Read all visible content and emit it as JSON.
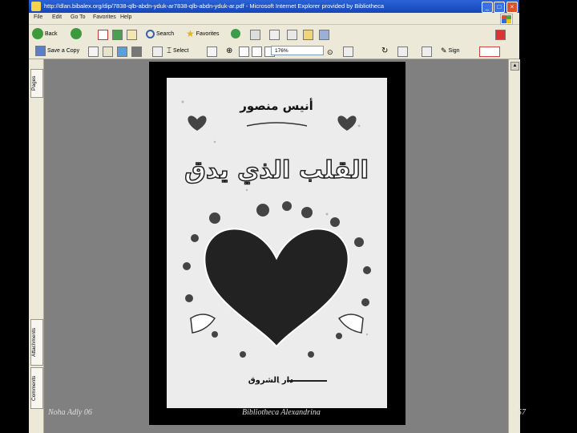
{
  "window": {
    "title": "http://dlan.bibalex.org/dip/7838-qlb-abdn-yduk-ar7838-qlb-abdn-yduk-ar.pdf - Microsoft Internet Explorer provided by Bibliotheca",
    "controls": [
      "_",
      "□",
      "×"
    ]
  },
  "menu": [
    "File",
    "Edit",
    "Go To",
    "Favorites",
    "Help"
  ],
  "toolbar1": {
    "back_label": "Back",
    "search_label": "Search",
    "favorites_label": "Favorites"
  },
  "toolbar2": {
    "save_label": "Save a Copy",
    "select_label": "Select",
    "zoom_value": "176%",
    "sign_label": "Sign"
  },
  "side_tabs": [
    "Pages",
    "Attachments",
    "Comments"
  ],
  "book_cover": {
    "author": "أنيس منصور",
    "title": "القلب الذي يدق",
    "publisher": "دار الشروق"
  },
  "slide_footer": {
    "author_date": "Noha Adly 06",
    "source": "Bibliotheca Alexandrina",
    "page_number": "57"
  },
  "colors": {
    "titlebar": "#1646b8",
    "chrome": "#ece9d8",
    "viewer_bg": "#808080",
    "slide_bg": "#000000"
  }
}
